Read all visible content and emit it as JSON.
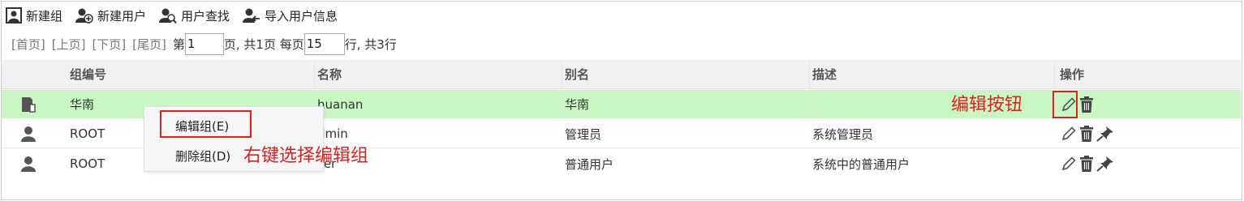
{
  "toolbar": {
    "new_group": "新建组",
    "new_user": "新建用户",
    "find_user": "用户查找",
    "import_user": "导入用户信息"
  },
  "pager": {
    "first": "[首页]",
    "prev": "[上页]",
    "next": "[下页]",
    "last": "[尾页]",
    "page_prefix": "第",
    "page_value": "1",
    "page_suffix": "页,  共1页 每页",
    "size_value": "15",
    "size_suffix": "行,  共3行"
  },
  "table": {
    "headers": {
      "id": "组编号",
      "name": "名称",
      "alias": "别名",
      "desc": "描述",
      "ops": "操作"
    },
    "rows": [
      {
        "id": "华南",
        "name": "huanan",
        "alias": "华南",
        "desc": "",
        "icon": "group-building-icon",
        "selected": true
      },
      {
        "id": "ROOT",
        "name": "dmin",
        "alias": "管理员",
        "desc": "系统管理员",
        "icon": "user-icon"
      },
      {
        "id": "ROOT",
        "name": "ser",
        "alias": "普通用户",
        "desc": "系统中的普通用户",
        "icon": "user-icon"
      }
    ]
  },
  "context_menu": {
    "edit": "编辑组(E)",
    "delete": "删除组(D)"
  },
  "annotations": {
    "right_click": "右键选择编辑组",
    "edit_button": "编辑按钮"
  },
  "colors": {
    "selected_row": "#c8f7c4",
    "header_bg": "#f1f1f1",
    "annotation_red": "#e0201f"
  }
}
